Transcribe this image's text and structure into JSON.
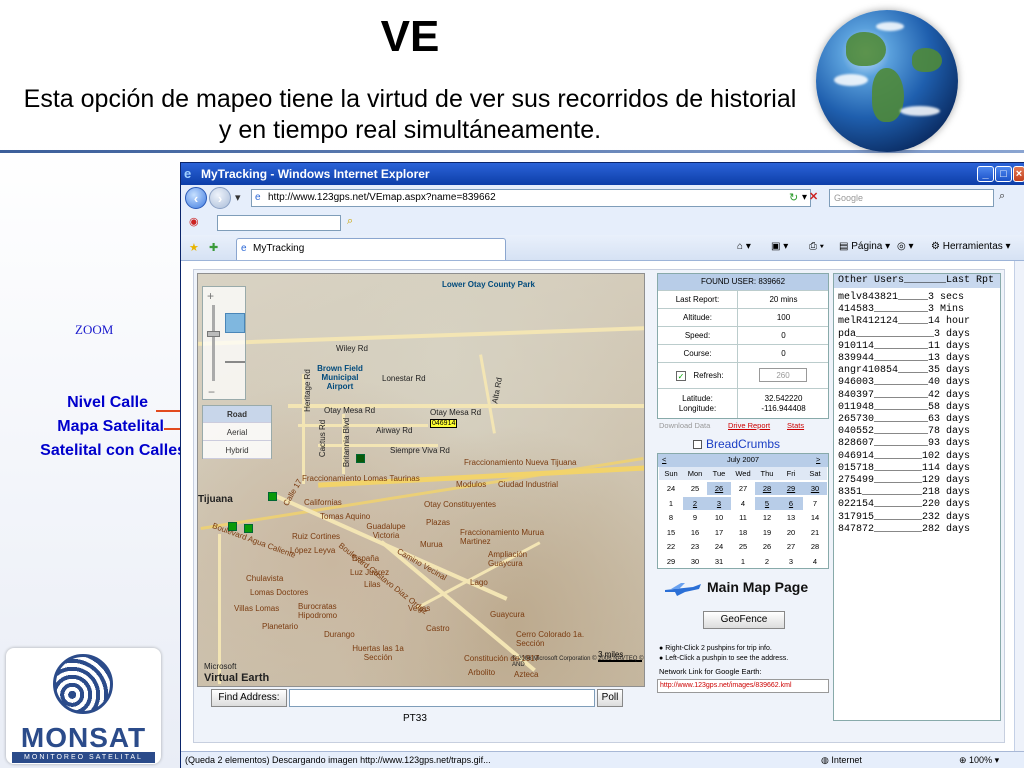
{
  "slide": {
    "title": "VE",
    "subtitle": "Esta opción de mapeo tiene la virtud de ver sus recorridos de historial y en tiempo real simultáneamente.",
    "zoom_label": "ZOOM",
    "annotations": [
      "Nivel Calle",
      "Mapa Satelital",
      "Satelital con Calles"
    ],
    "logo_text": "MONSAT",
    "logo_sub": "MONITOREO SATELITAL"
  },
  "browser": {
    "window_title": "MyTracking - Windows Internet Explorer",
    "url": "http://www.123gps.net/VEmap.aspx?name=839662",
    "search_placeholder": "Google",
    "tab_label": "MyTracking",
    "cmd_page": "Página",
    "cmd_tools": "Herramientas",
    "status_text": "(Queda 2 elementos) Descargando imagen http://www.123gps.net/traps.gif...",
    "status_zone": "Internet",
    "zoom_level": "100%"
  },
  "map": {
    "labels": [
      "Lower Otay County Park",
      "Wiley Rd",
      "Brown Field Municipal Airport",
      "Lonestar Rd",
      "Otay Mesa Rd",
      "Otay Mesa Rd",
      "Airway Rd",
      "Siempre Viva Rd",
      "Alta Rd",
      "Heritage Rd",
      "Cactus Rd",
      "Britannia Blvd",
      "Fraccionamiento Nueva Tijuana",
      "Fraccionamiento Lomas Taurinas",
      "Modulos",
      "Ciudad Industrial",
      "Tijuana",
      "Calle 17",
      "Californias",
      "Tomas Aquino",
      "Otay Constituyentes",
      "Guadalupe Victoria",
      "Plazas",
      "Fraccionamiento Murua Martinez",
      "Ruiz Cortines",
      "López Leyva",
      "Murua",
      "Ampliación Guaycura",
      "España",
      "Luz Juárez",
      "Chulavista",
      "Lomas Doctores",
      "Lilas",
      "Lago",
      "Villas Lomas",
      "Burocratas Hipodromo",
      "Vegas",
      "Planetario",
      "Durango",
      "Guaycura",
      "Castro",
      "Cerro Colorado 1a. Sección",
      "Huertas las 1a Sección",
      "Constitución de 1917",
      "Azteca",
      "Arbolito",
      "Boulevard Agua Caliente",
      "Camino Vecinal",
      "Boulevard Gustavo Diaz Ordaz"
    ],
    "flag_id": "046914",
    "scale": "3 miles",
    "ms_label": "Microsoft",
    "ve_label": "Virtual Earth",
    "copyright": "© 2006 Microsoft Corporation  © 2006 NAVTEQ  © AND",
    "views": [
      "Road",
      "Aerial",
      "Hybrid"
    ],
    "find_label": "Find Address:",
    "poll_label": "Poll",
    "unit_name": "PT33"
  },
  "info": {
    "header": "FOUND USER: 839662",
    "rows": [
      {
        "k": "Last Report:",
        "v": "20 mins"
      },
      {
        "k": "Altitude:",
        "v": "100"
      },
      {
        "k": "Speed:",
        "v": "0"
      },
      {
        "k": "Course:",
        "v": "0"
      }
    ],
    "refresh_label": "Refresh:",
    "refresh_value": "260",
    "latlon_label": "Latitude: Longitude:",
    "lat": "32.542220",
    "lon": "-116.944408",
    "download": "Download Data",
    "drive_report": "Drive Report",
    "stats": "Stats",
    "breadcrumbs": "BreadCrumbs"
  },
  "calendar": {
    "month": "July 2007",
    "prev": "<",
    "next": ">",
    "days": [
      "Sun",
      "Mon",
      "Tue",
      "Wed",
      "Thu",
      "Fri",
      "Sat"
    ],
    "weeks": [
      [
        "24",
        "25",
        "26",
        "27",
        "28",
        "29",
        "30"
      ],
      [
        "1",
        "2",
        "3",
        "4",
        "5",
        "6",
        "7"
      ],
      [
        "8",
        "9",
        "10",
        "11",
        "12",
        "13",
        "14"
      ],
      [
        "15",
        "16",
        "17",
        "18",
        "19",
        "20",
        "21"
      ],
      [
        "22",
        "23",
        "24",
        "25",
        "26",
        "27",
        "28"
      ],
      [
        "29",
        "30",
        "31",
        "1",
        "2",
        "3",
        "4"
      ]
    ]
  },
  "actions": {
    "main_map": "Main Map Page",
    "geofence": "GeoFence",
    "tip1": "Right-Click 2 pushpins for trip info.",
    "tip2": "Left-Click a pushpin to see the address.",
    "ge_label": "Network Link for Google Earth:",
    "ge_link": "http://www.123gps.net/images/839662.kml"
  },
  "others": {
    "header": "Other Users_______Last Rpt",
    "rows": [
      "melv843821_____3 secs",
      "414583_________3 Mins",
      "melR412124_____14 hour",
      "pda_____________3 days",
      "910114_________11 days",
      "839944_________13 days",
      "angr410854_____35 days",
      "946003_________40 days",
      "840397_________42 days",
      "011948_________58 days",
      "265730_________63 days",
      "040552_________78 days",
      "828607_________93 days",
      "046914________102 days",
      "015718________114 days",
      "275499________129 days",
      "8351__________218 days",
      "022154________220 days",
      "317915________232 days",
      "847872________282 days"
    ]
  }
}
